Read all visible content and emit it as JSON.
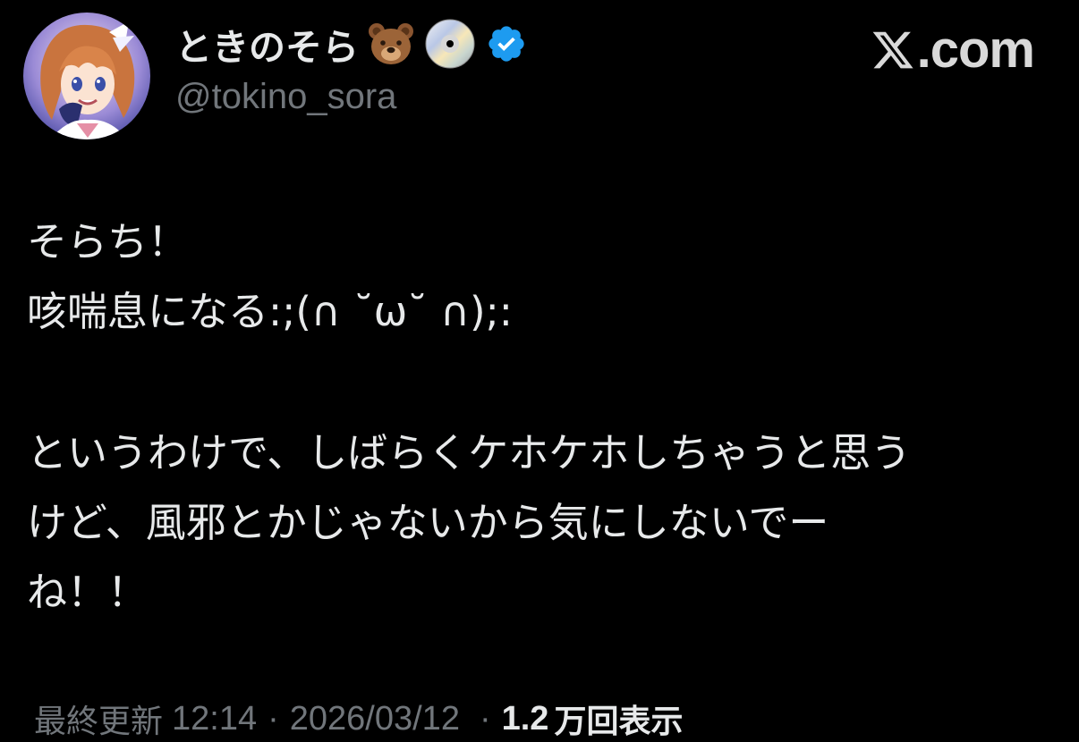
{
  "author": {
    "display_name": "ときのそら",
    "handle": "@tokino_sora",
    "badge_icons": [
      "bear-emoji",
      "disc-emoji",
      "verified-badge"
    ],
    "verified_color": "#1d9bf0"
  },
  "brand": {
    "name": ".com",
    "icon": "x-logo-icon"
  },
  "tweet": {
    "lines": [
      "そらち！",
      "咳喘息になる:;(∩ ˘ω˘ ∩);:",
      "",
      "というわけで、しばらくケホケホしちゃうと思う",
      "けど、風邪とかじゃないから気にしないでー",
      "ね！！"
    ]
  },
  "meta": {
    "updated_label": "最終更新",
    "time": "12:14",
    "separator": "·",
    "date": "2026/03/12",
    "views_count": "1.2",
    "views_unit": "万回表示"
  },
  "colors": {
    "background": "#000000",
    "text_primary": "#e7e9ea",
    "text_secondary": "#71767b",
    "accent": "#1d9bf0"
  }
}
